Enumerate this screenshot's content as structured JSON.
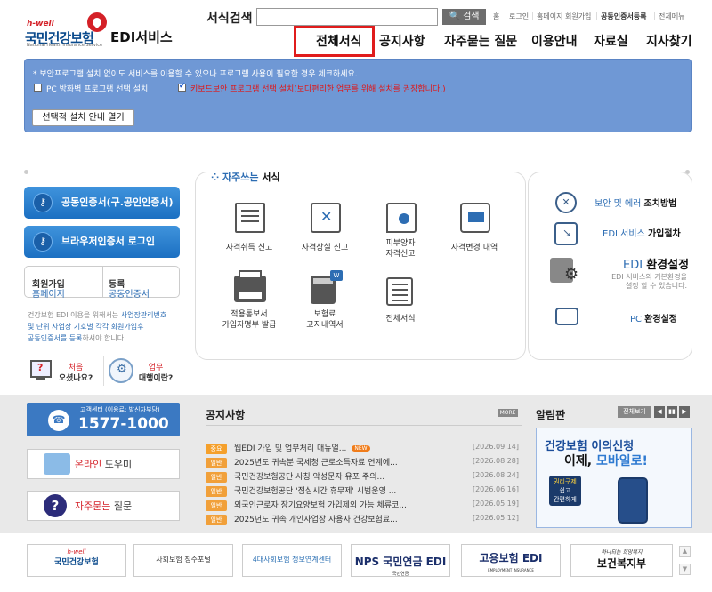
{
  "header": {
    "logo_hwell": "h-well",
    "logo_main": "국민건강보험",
    "logo_sub": "National Health Insurance Service",
    "edi_title": "EDI서비스",
    "search_label": "서식검색",
    "search_value": "",
    "search_button": "검색",
    "utils": [
      "홈",
      "로그인",
      "홈페이지 회원가입",
      "공동인증서등록",
      "전체메뉴"
    ]
  },
  "nav": [
    "전체서식",
    "공지사항",
    "자주묻는 질문",
    "이용안내",
    "자료실",
    "지사찾기"
  ],
  "install": {
    "note": "* 보안프로그램 설치 없이도 서비스를 이용할 수 있으나 프로그램 사용이 필요한 경우 체크하세요.",
    "opt1": "PC 방화벽 프로그램 선택 설치",
    "opt2": "키보드보안 프로그램 선택 설치(보다편리한 업무를 위해 설치를 권장합니다.)",
    "button": "선택적 설치 안내 열기"
  },
  "left": {
    "cert_login": "공동인증서(구.공인인증서)",
    "browser_login": "브라우저인증서 로그인",
    "reg_a_pre": "홈페이지",
    "reg_a": "회원가입",
    "reg_b_pre": "공동인증서",
    "reg_b": "등록",
    "info_1": "건강보험 EDI 이용을 위해서는",
    "info_2": "사업장관리번호",
    "info_3": "및 단위 사업장 기호별 각각 회원가입후",
    "info_4": "공동인증서를 등록",
    "info_5": "하셔야 합니다.",
    "first_a": "처음",
    "first_b": "오셨나요?",
    "agent_a": "업무",
    "agent_b": "대행이란?"
  },
  "forms": {
    "title_a": "자주쓰는",
    "title_b": "서식",
    "items": [
      "자격취득 신고",
      "자격상실 신고",
      "피부양자\n자격신고",
      "자격변경 내역",
      "적용통보서\n가입자명부 발급",
      "보험료\n고지내역서",
      "전체서식"
    ]
  },
  "right": {
    "item1_a": "보안 및 에러",
    "item1_b": "조치방법",
    "item2_a": "EDI 서비스",
    "item2_b": "가입절차",
    "item3_a": "EDI",
    "item3_b": "환경설정",
    "item3_desc": "EDI 서비스의 기본환경을\n설정 할 수 있습니다.",
    "item4_a": "PC",
    "item4_b": "환경설정"
  },
  "bottom": {
    "cc_label": "고객센터 (이용료: 발신자부담)",
    "cc_number": "1577-1000",
    "online_a": "온라인",
    "online_b": "도우미",
    "faq_a": "자주묻는",
    "faq_b": "질문",
    "notice_title": "공지사항",
    "more": "MORE",
    "notices": [
      {
        "tag": "중요",
        "title": "웹EDI 가입 및 업무처리 매뉴얼...",
        "date": "[2026.09.14]",
        "new": "NEW"
      },
      {
        "tag": "일반",
        "title": "2025년도 귀속분 국세청 근로소득자료 연계에...",
        "date": "[2026.08.28]",
        "new": ""
      },
      {
        "tag": "일반",
        "title": "국민건강보험공단 사칭 악성문자 유포 주의...",
        "date": "[2026.08.24]",
        "new": ""
      },
      {
        "tag": "일반",
        "title": "국민건강보험공단 '점심시간 휴무제' 시범운영 ...",
        "date": "[2026.06.16]",
        "new": ""
      },
      {
        "tag": "일반",
        "title": "외국인근로자 장기요양보험 가입제외 가능 체류코...",
        "date": "[2026.05.19]",
        "new": ""
      },
      {
        "tag": "일반",
        "title": "2025년도 귀속 개인사업장 사용자 건강보험료...",
        "date": "[2026.05.12]",
        "new": ""
      }
    ],
    "alarm_title": "알림판",
    "all_view": "전체보기",
    "banner_t1": "건강보험 이의신청",
    "banner_t2_a": "이제,",
    "banner_t2_b": "모바일로!",
    "sticker_a": "권리구제",
    "sticker_b": "쉽고",
    "sticker_c": "간편하게"
  },
  "footer": {
    "logos": [
      "국민건강보험",
      "사회보험 징수포털",
      "4대사회보험 정보연계센터",
      "NPS 국민연금 EDI",
      "고용보험 EDI",
      "보건복지부"
    ],
    "hwell": "h-well",
    "nps_tag": "국민연금",
    "emp_tag": "EMPLOYMENT INSURANCE",
    "mohw_slogan": "하나되는 희망복지"
  }
}
